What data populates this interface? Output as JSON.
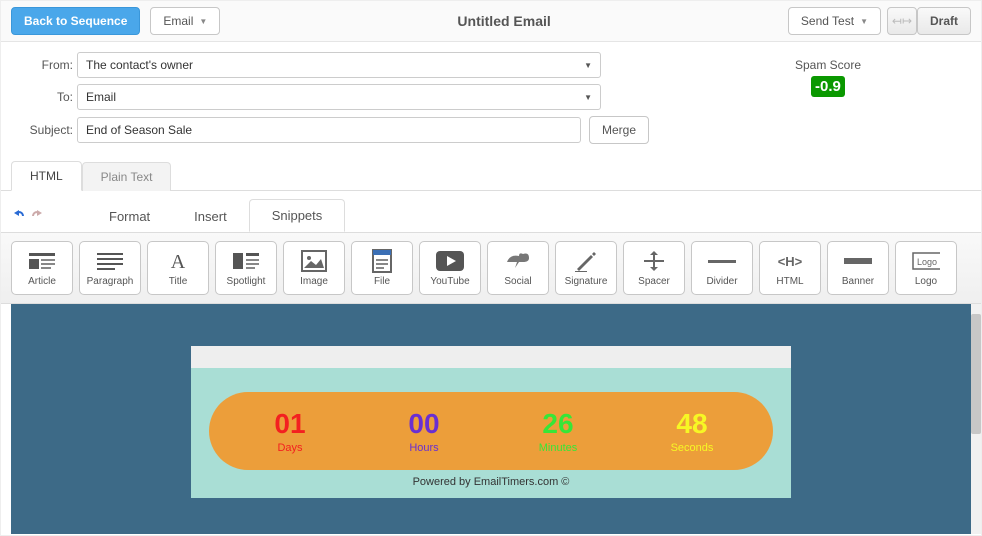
{
  "topbar": {
    "back": "Back to Sequence",
    "email_dd": "Email",
    "title": "Untitled Email",
    "send_test": "Send Test",
    "draft": "Draft"
  },
  "form": {
    "from_label": "From:",
    "from_value": "The contact's owner",
    "to_label": "To:",
    "to_value": "Email",
    "subject_label": "Subject:",
    "subject_value": "End of Season Sale",
    "merge": "Merge"
  },
  "spam": {
    "label": "Spam Score",
    "value": "-0.9"
  },
  "tabs": {
    "html": "HTML",
    "plain": "Plain Text"
  },
  "etabs": {
    "format": "Format",
    "insert": "Insert",
    "snippets": "Snippets"
  },
  "snips": [
    {
      "k": "article",
      "l": "Article"
    },
    {
      "k": "paragraph",
      "l": "Paragraph"
    },
    {
      "k": "title",
      "l": "Title"
    },
    {
      "k": "spotlight",
      "l": "Spotlight"
    },
    {
      "k": "image",
      "l": "Image"
    },
    {
      "k": "file",
      "l": "File"
    },
    {
      "k": "youtube",
      "l": "YouTube"
    },
    {
      "k": "social",
      "l": "Social"
    },
    {
      "k": "signature",
      "l": "Signature"
    },
    {
      "k": "spacer",
      "l": "Spacer"
    },
    {
      "k": "divider",
      "l": "Divider"
    },
    {
      "k": "html",
      "l": "HTML"
    },
    {
      "k": "banner",
      "l": "Banner"
    },
    {
      "k": "logo",
      "l": "Logo"
    }
  ],
  "timer": {
    "days_n": "01",
    "days_l": "Days",
    "hours_n": "00",
    "hours_l": "Hours",
    "min_n": "26",
    "min_l": "Minutes",
    "sec_n": "48",
    "sec_l": "Seconds",
    "powered": "Powered by EmailTimers.com ©"
  }
}
